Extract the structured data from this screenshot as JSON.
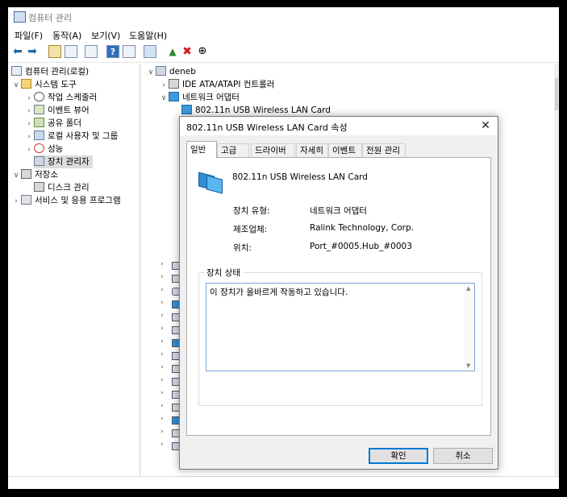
{
  "window": {
    "title": "컴퓨터 관리"
  },
  "menu": [
    "파일(F)",
    "동작(A)",
    "보기(V)",
    "도움말(H)"
  ],
  "toolbar": {
    "icons": [
      "back-arrow-icon",
      "forward-arrow-icon",
      "folder-up-icon",
      "properties-grid-icon",
      "list-icon",
      "help-icon",
      "toggle-pane-icon",
      "monitor-icon",
      "update-driver-icon",
      "uninstall-x-icon",
      "scan-hardware-icon"
    ],
    "accent": "#1f6aa6",
    "delete_color": "#d11a1a"
  },
  "tree": {
    "root": "컴퓨터 관리(로컬)",
    "system_tools": "시스템 도구",
    "task_scheduler": "작업 스케줄러",
    "event_viewer": "이벤트 뷰어",
    "shared_folders": "공유 폴더",
    "local_users": "로컬 사용자 및 그룹",
    "performance": "성능",
    "device_manager": "장치 관리자",
    "storage": "저장소",
    "disk_management": "디스크 관리",
    "services": "서비스 및 응용 프로그램"
  },
  "devices": {
    "computer": "deneb",
    "ide": "IDE ATA/ATAPI 컨트롤러",
    "network": "네트워크 어댑터",
    "wifi": "802.11n USB Wireless LAN Card"
  },
  "dialog": {
    "title": "802.11n USB Wireless LAN Card 속성",
    "tabs": [
      "일반",
      "고급",
      "드라이버",
      "자세히",
      "이벤트",
      "전원 관리"
    ],
    "device_name": "802.11n USB Wireless LAN Card",
    "type_label": "장치 유형:",
    "type_value": "네트워크 어댑터",
    "mfr_label": "제조업체:",
    "mfr_value": "Ralink Technology, Corp.",
    "loc_label": "위치:",
    "loc_value": "Port_#0005.Hub_#0003",
    "status_group": "장치 상태",
    "status_text": "이 장치가 올바르게 작동하고 있습니다.",
    "ok": "확인",
    "cancel": "취소"
  }
}
